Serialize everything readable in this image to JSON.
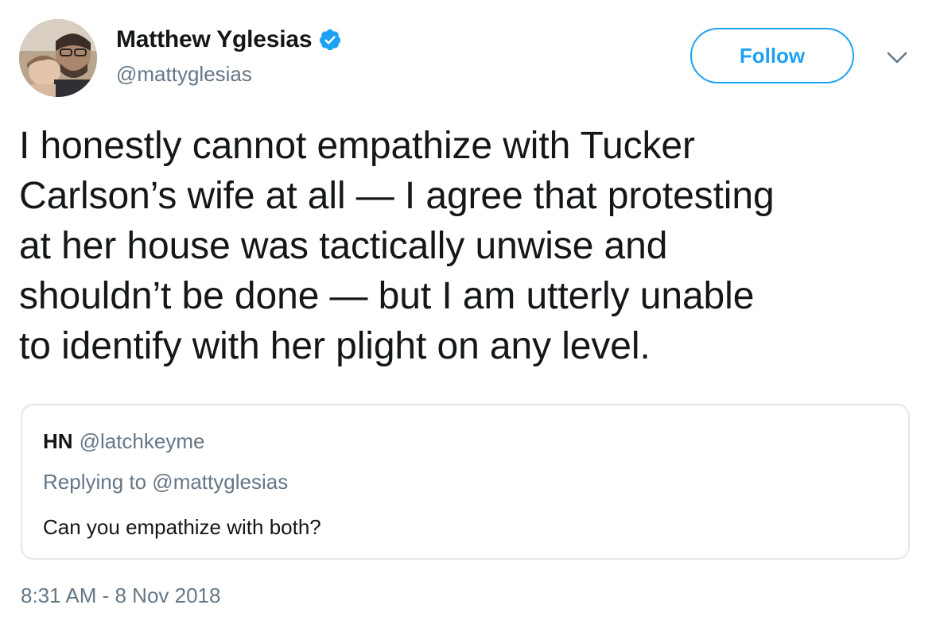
{
  "tweet": {
    "author": {
      "display_name": "Matthew Yglesias",
      "handle": "@mattyglesias",
      "verified_icon": "verified-badge-icon",
      "avatar_icon": "avatar-photo"
    },
    "follow_label": "Follow",
    "menu_icon": "chevron-down-icon",
    "text": "I honestly cannot empathize with Tucker\nCarlson’s wife at all — I agree that protesting\nat her house was tactically unwise and\nshouldn’t be done — but I am utterly unable\nto identify with her plight on any level.",
    "timestamp": "8:31 AM - 8 Nov 2018"
  },
  "quoted_tweet": {
    "name": "HN",
    "handle": "@latchkeyme",
    "replying_to": "Replying to @mattyglesias",
    "text": "Can you empathize with both?"
  },
  "colors": {
    "accent": "#1da1f2",
    "text": "#14171a",
    "secondary_text": "#657786",
    "border": "#e1e8ed"
  }
}
